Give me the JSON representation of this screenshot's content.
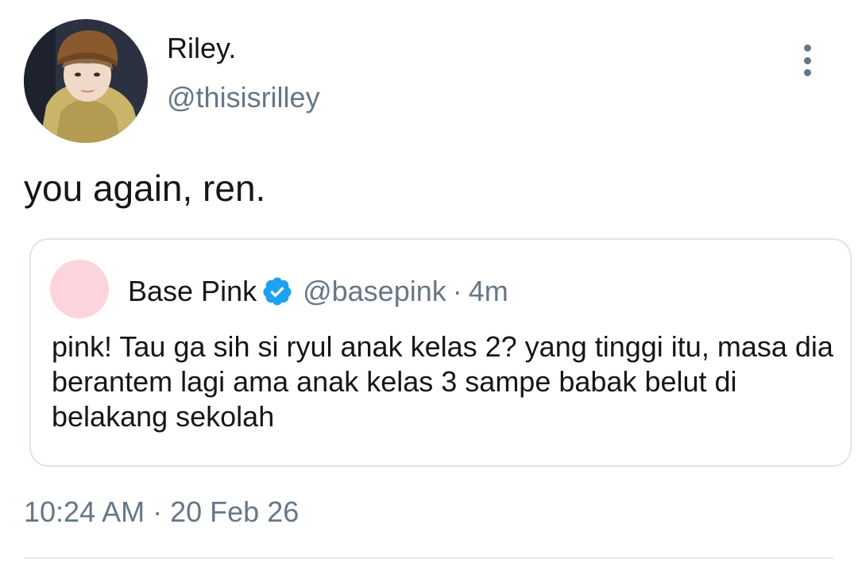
{
  "tweet": {
    "author": {
      "display_name": "Riley.",
      "handle": "@thisisrilley",
      "avatar": "profile-photo"
    },
    "more_icon": "more-vertical-icon",
    "text": "you again, ren.",
    "quoted_tweet": {
      "author_name": "Base Pink",
      "verified_icon": "verified-badge-icon",
      "handle": "@basepink",
      "separator": "·",
      "time": "4m",
      "text": "pink! Tau ga sih si ryul anak kelas 2? yang tinggi itu, masa dia berantem lagi ama anak kelas 3 sampe babak belut di belakang sekolah",
      "avatar_color": "#fcd4de"
    },
    "timestamp": {
      "time": "10:24 AM",
      "separator": "·",
      "date": "20 Feb 26"
    }
  },
  "colors": {
    "primary_text": "#14171a",
    "secondary_text": "#657786",
    "verified_blue": "#1da1f2",
    "border": "#dfe5ea"
  }
}
